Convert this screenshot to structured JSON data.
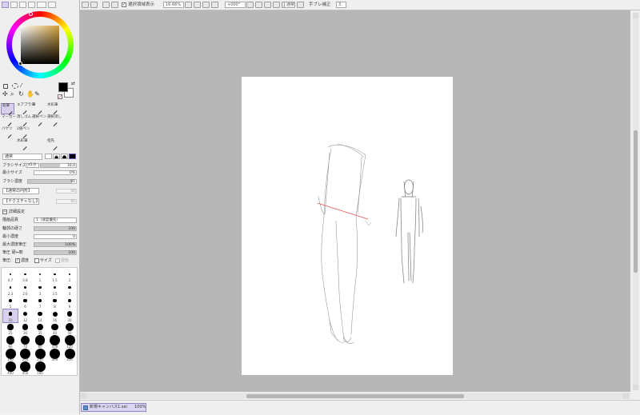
{
  "window": {
    "title": "新規キャンバス1.sai",
    "zoom": "100%"
  },
  "toolbar": {
    "selection_display_label": "選択領域表示",
    "selection_display_checked": true,
    "zoom_value": "16.66%",
    "rotation_value": "+000°",
    "blend_mode": "通常",
    "stabilizer_label": "手ブレ補正",
    "stabilizer_value": "3"
  },
  "color": {
    "foreground": "#000000",
    "background": "#ffffff",
    "wheel_hue_accent": "#d4a23c"
  },
  "tool_grid": [
    [
      "鉛筆",
      "エアブラシ",
      "筆",
      "水彩筆",
      ""
    ],
    [
      "マーカー",
      "消しゴム",
      "選択ペン",
      "選択消し",
      ""
    ],
    [
      "バケツ",
      "2値ペン",
      "",
      "",
      ""
    ],
    [
      "",
      "水彩筆",
      "",
      "指先",
      ""
    ]
  ],
  "brush": {
    "mode": "通常",
    "size_label": "ブラシサイズ",
    "size_multiplier": "x1.0",
    "size_value": "16.0",
    "min_size_label": "最小サイズ",
    "min_size_value": "0%",
    "density_label": "ブラシ濃度",
    "density_value": "91",
    "shape_label": "【通常の円形】",
    "shape_value": "50",
    "texture_label": "【テクスチャなし】",
    "texture_value": "95",
    "advanced_label": "詳細設定",
    "quality_label": "描画品質",
    "quality_value": "1（速度優先）",
    "edge_hardness_label": "輪郭の硬さ",
    "edge_hardness_value": "100",
    "min_density_label": "最小濃度",
    "min_density_value": "0",
    "max_density_pressure_label": "最大濃度筆圧",
    "max_density_pressure_value": "100%",
    "pressure_label": "筆圧 硬⇔軟",
    "pressure_value": "100",
    "pressure_density_label": "筆圧:",
    "density_check_label": "濃度",
    "size_check_label": "サイズ",
    "blend_check_label": "混色"
  },
  "brush_sizes": [
    [
      "0.7",
      "0.8",
      "1",
      "1.5",
      "2"
    ],
    [
      "2.3",
      "2.6",
      "3",
      "3.5",
      "4"
    ],
    [
      "5",
      "6",
      "7",
      "8",
      "9"
    ],
    [
      "10",
      "12",
      "14",
      "16",
      "20"
    ],
    [
      "25",
      "30",
      "35",
      "40",
      "50"
    ],
    [
      "60",
      "70",
      "80",
      "100",
      "120"
    ],
    [
      "160",
      "200",
      "250",
      "300",
      "350"
    ],
    [
      "400",
      "450",
      "500"
    ]
  ]
}
